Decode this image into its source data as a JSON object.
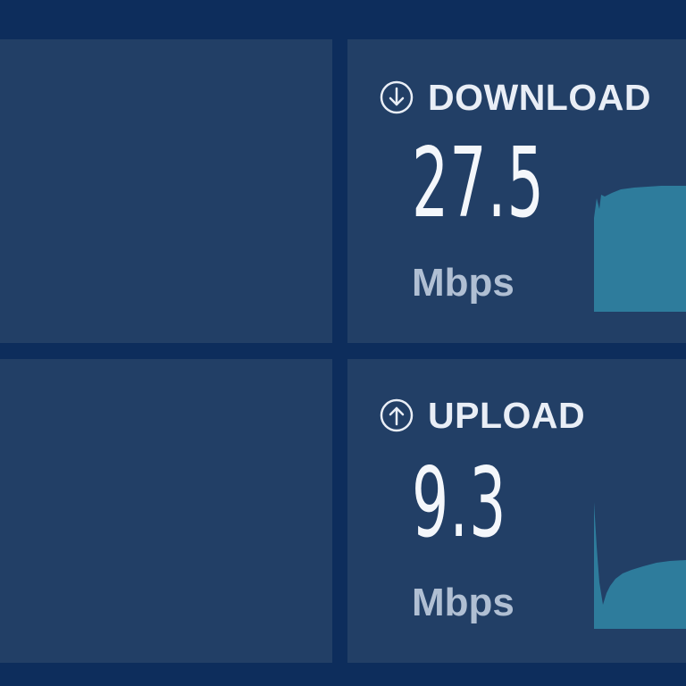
{
  "download": {
    "icon": "arrow-down-circle-icon",
    "title": "DOWNLOAD",
    "value": "27.5",
    "unit": "Mbps"
  },
  "upload": {
    "icon": "arrow-up-circle-icon",
    "title": "UPLOAD",
    "value": "9.3",
    "unit": "Mbps"
  },
  "colors": {
    "background": "#0d2d5c",
    "panel": "#223f66",
    "graph_fill": "#2e7c9c",
    "text": "#e9eef6",
    "unit_text": "#b0bfd3"
  }
}
